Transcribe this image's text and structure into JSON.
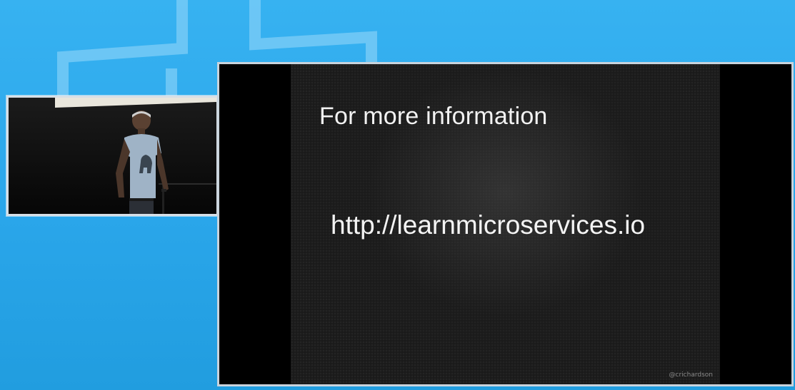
{
  "colors": {
    "background": "#2aa3e6",
    "slide_background": "#1a1a1a",
    "slide_text": "#f2f2f2",
    "frame_border": "#c9d3dc"
  },
  "speaker_video": {
    "shirt_icon": "bear-silhouette-icon"
  },
  "slide": {
    "title": "For more information",
    "url": "http://learnmicroservices.io",
    "handle": "@crichardson"
  }
}
